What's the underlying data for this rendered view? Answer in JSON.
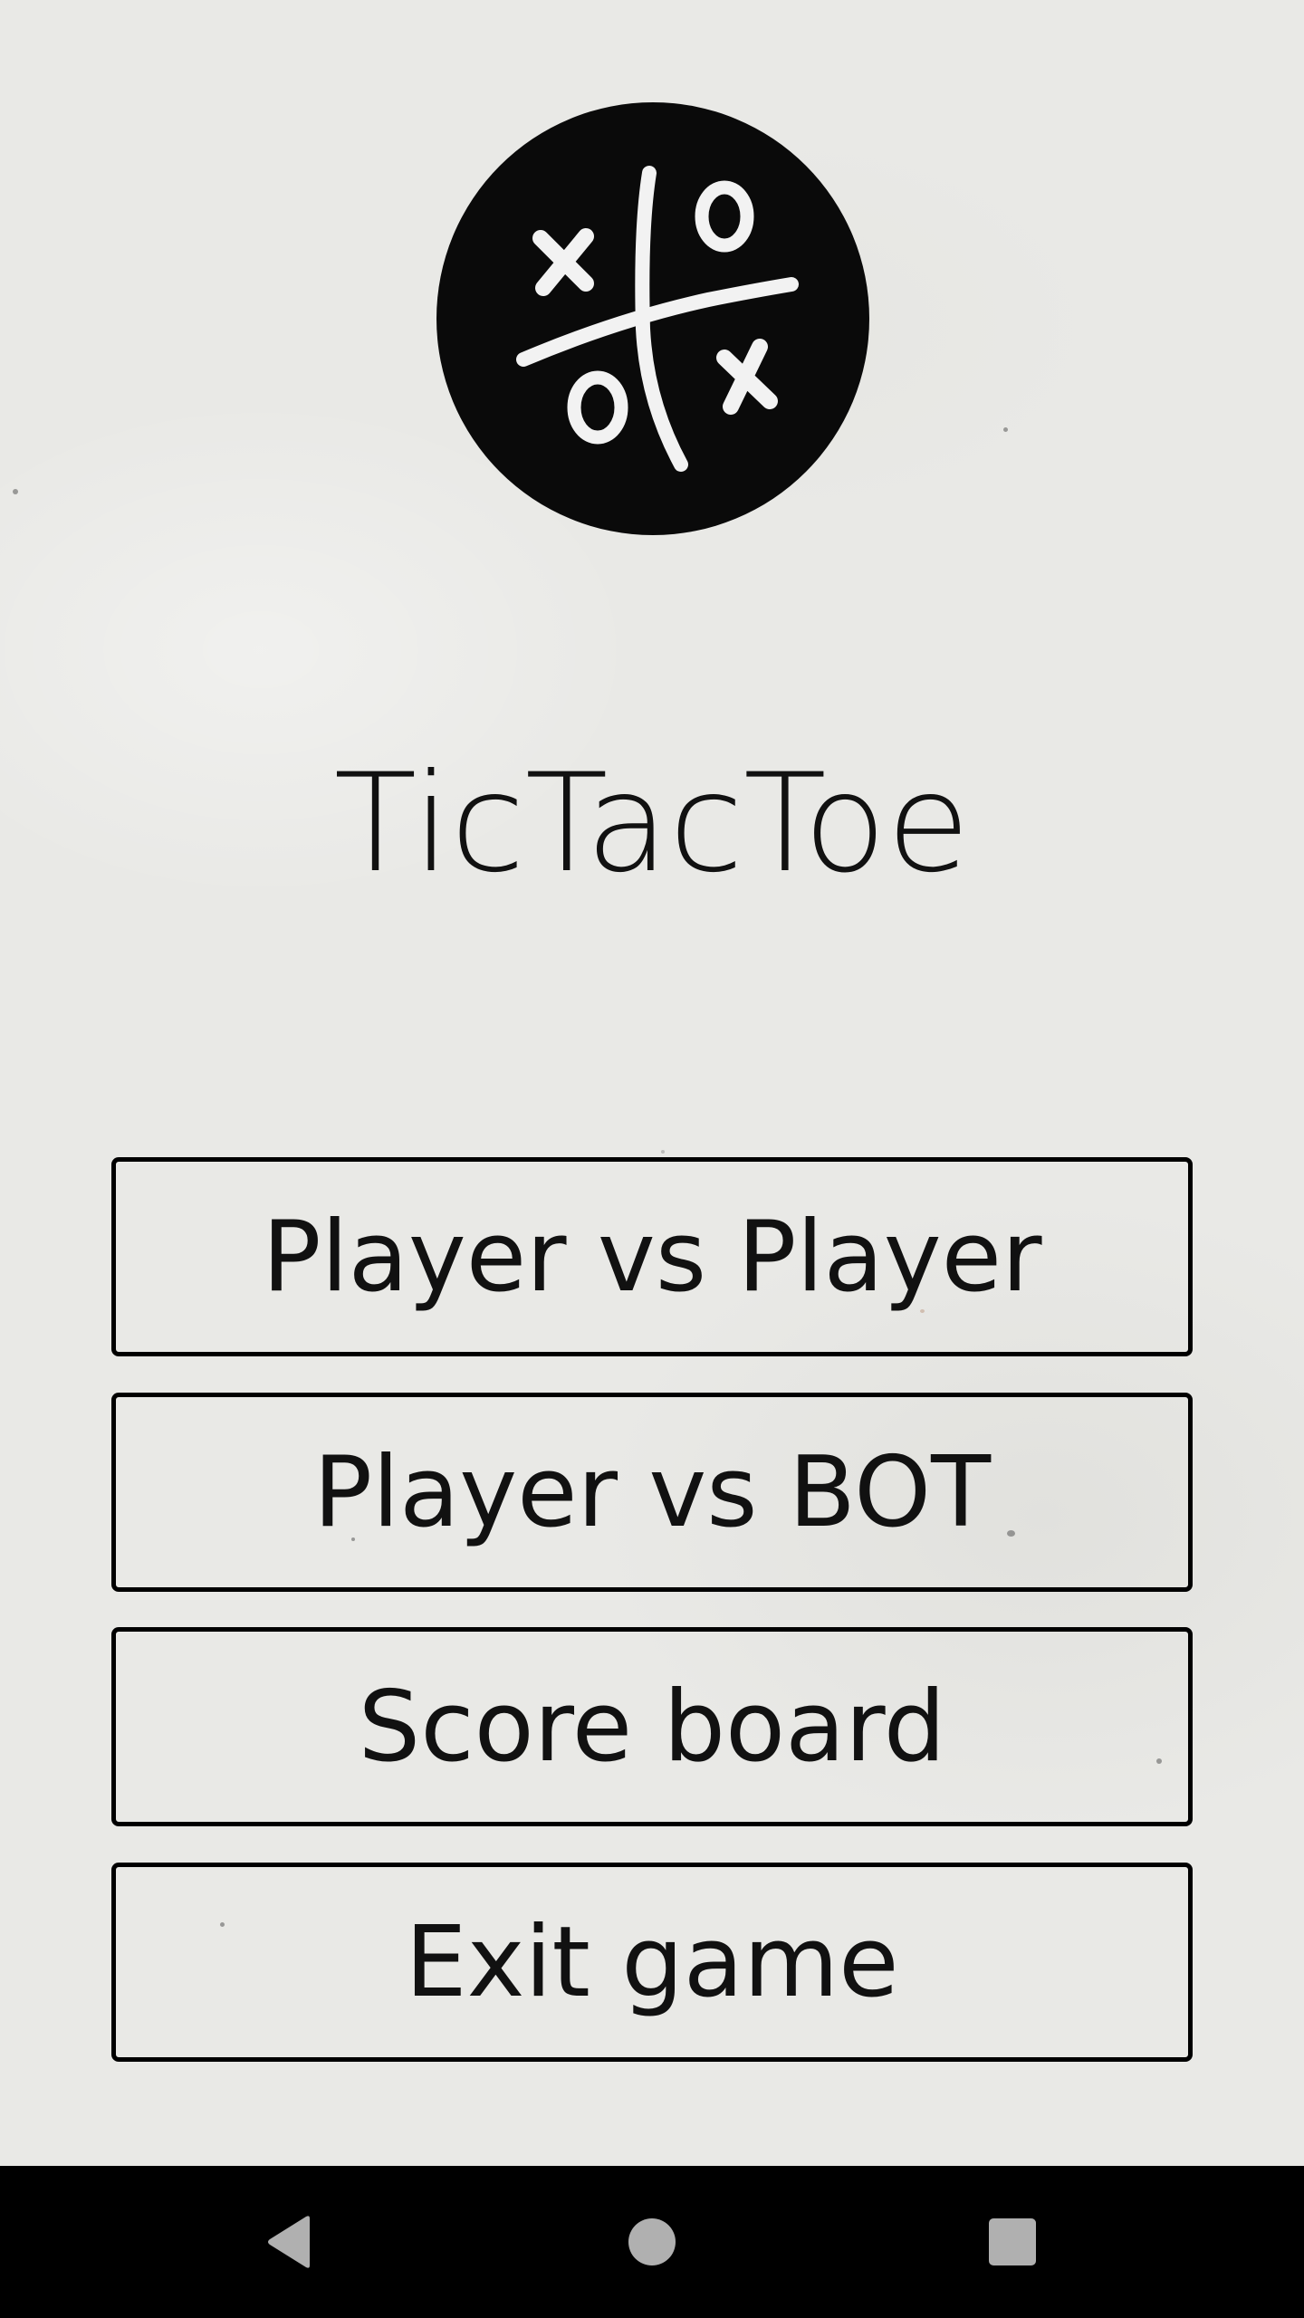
{
  "app": {
    "title": "TicTacToe",
    "logo_icon": "tic-tac-toe-logo"
  },
  "menu": {
    "buttons": [
      {
        "label": "Player vs Player"
      },
      {
        "label": "Player vs BOT"
      },
      {
        "label": "Score board"
      },
      {
        "label": "Exit game"
      }
    ]
  },
  "navigation_bar": {
    "back_icon": "back-triangle-icon",
    "home_icon": "home-circle-icon",
    "recents_icon": "recents-square-icon"
  },
  "colors": {
    "background": "#e9e9e6",
    "text": "#111111",
    "button_border": "#000000",
    "logo_fill": "#0a0a0a",
    "logo_marks": "#f2f2f2",
    "navbar": "#000000",
    "nav_icons": "#b0b0b0"
  }
}
